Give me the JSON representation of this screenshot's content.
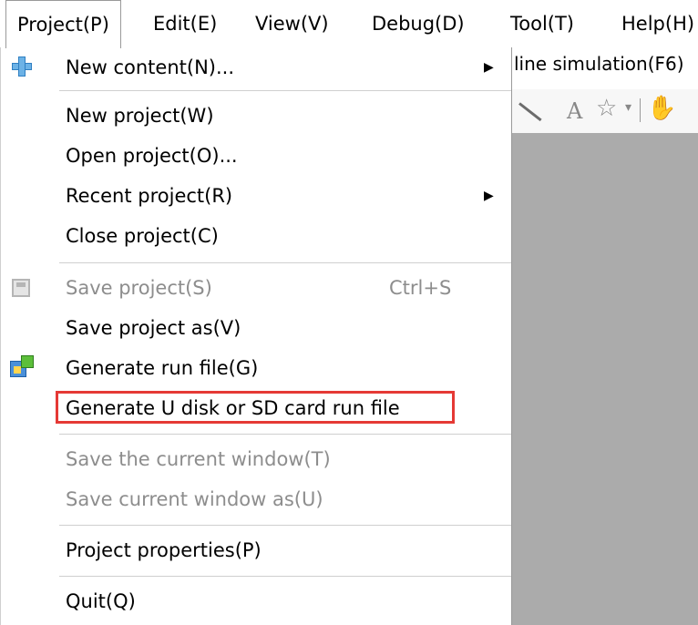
{
  "menubar": {
    "items": [
      {
        "label": "Project(P)"
      },
      {
        "label": "Edit(E)"
      },
      {
        "label": "View(V)"
      },
      {
        "label": "Debug(D)"
      },
      {
        "label": "Tool(T)"
      },
      {
        "label": "Help(H)"
      }
    ]
  },
  "background": {
    "simulation_label": "line simulation(F6)",
    "toolbar_text_glyph": "A"
  },
  "dropdown": {
    "items": [
      {
        "label": "New content(N)...",
        "has_submenu": true,
        "enabled": true,
        "icon": "plus-icon"
      },
      {
        "label": "New project(W)",
        "enabled": true
      },
      {
        "label": "Open project(O)...",
        "enabled": true
      },
      {
        "label": "Recent project(R)",
        "has_submenu": true,
        "enabled": true
      },
      {
        "label": "Close project(C)",
        "enabled": true
      },
      {
        "label": "Save project(S)",
        "shortcut": "Ctrl+S",
        "enabled": false,
        "icon": "save-icon"
      },
      {
        "label": "Save project as(V)",
        "enabled": true
      },
      {
        "label": "Generate run file(G)",
        "enabled": true,
        "icon": "generate-icon"
      },
      {
        "label": "Generate U disk or SD card run file",
        "enabled": true,
        "highlighted": true
      },
      {
        "label": "Save the current window(T)",
        "enabled": false
      },
      {
        "label": "Save current window as(U)",
        "enabled": false
      },
      {
        "label": "Project properties(P)",
        "enabled": true
      },
      {
        "label": "Quit(Q)",
        "enabled": true
      }
    ]
  },
  "colors": {
    "highlight_border": "#e53935",
    "disabled_text": "#8d8d8d",
    "canvas_gray": "#ababab"
  }
}
